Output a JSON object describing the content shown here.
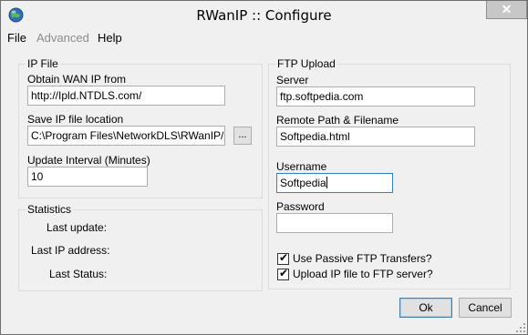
{
  "window": {
    "title": "RWanIP :: Configure"
  },
  "titlebar": {
    "close_glyph": "✕"
  },
  "menu": [
    {
      "label": "File",
      "enabled": true
    },
    {
      "label": "Advanced",
      "enabled": false
    },
    {
      "label": "Help",
      "enabled": true
    }
  ],
  "ip_file": {
    "group_title": "IP File",
    "obtain_label": "Obtain WAN IP from",
    "obtain_value": "http://Ipld.NTDLS.com/",
    "save_label": "Save IP file location",
    "save_value": "C:\\Program Files\\NetworkDLS\\RWanIP/Las",
    "browse_label": "...",
    "interval_label": "Update Interval (Minutes)",
    "interval_value": "10"
  },
  "statistics": {
    "group_title": "Statistics",
    "last_update_label": "Last update:",
    "last_ip_label": "Last IP address:",
    "last_status_label": "Last Status:"
  },
  "ftp": {
    "group_title": "FTP Upload",
    "server_label": "Server",
    "server_value": "ftp.softpedia.com",
    "remote_path_label": "Remote Path & Filename",
    "remote_path_value": "Softpedia.html",
    "username_label": "Username",
    "username_value": "Softpedia",
    "password_label": "Password",
    "password_value": "",
    "passive_label": "Use Passive FTP Transfers?",
    "passive_checked": true,
    "upload_label": "Upload IP file to FTP server?",
    "upload_checked": true,
    "check_glyph": "✔"
  },
  "buttons": {
    "ok": "Ok",
    "cancel": "Cancel"
  },
  "icons": {
    "app": "globe-icon",
    "close": "close-icon",
    "resize": "resize-grip-icon"
  }
}
